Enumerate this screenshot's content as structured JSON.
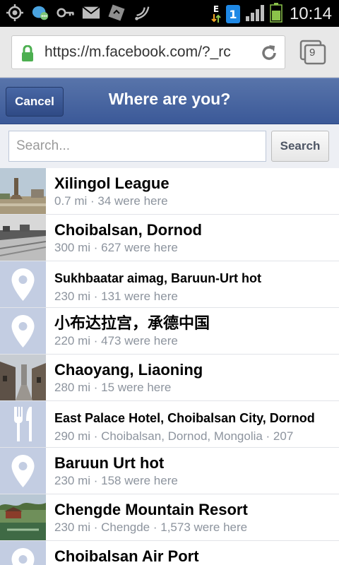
{
  "status_bar": {
    "time": "10:14",
    "sim_label": "1",
    "data_label": "E",
    "icons": [
      "gps-icon",
      "chat-icon",
      "key-icon",
      "mail-icon",
      "flip-icon",
      "nfc-icon",
      "data-icon",
      "sim-icon",
      "signal-icon",
      "battery-icon"
    ]
  },
  "browser": {
    "url": "https://m.facebook.com/?_rc",
    "tab_count": "9"
  },
  "header": {
    "cancel_label": "Cancel",
    "title": "Where are you?"
  },
  "search": {
    "placeholder": "Search...",
    "button_label": "Search"
  },
  "places": [
    {
      "title": "Xilingol League",
      "subtitle": "0.7 mi · 34 were here",
      "thumb": "photo-monument"
    },
    {
      "title": "Choibalsan, Dornod",
      "subtitle": "300 mi · 627 were here",
      "thumb": "photo-bw-town"
    },
    {
      "title": "Sukhbaatar aimag, Baruun-Urt hot",
      "subtitle": "230 mi · 131 were here",
      "thumb": "pin-icon"
    },
    {
      "title": "小布达拉宫，承德中国",
      "subtitle": "220 mi · 473 were here",
      "thumb": "pin-icon"
    },
    {
      "title": "Chaoyang, Liaoning",
      "subtitle": "280 mi · 15 were here",
      "thumb": "photo-street"
    },
    {
      "title": "East Palace Hotel, Choibalsan City, Dornod",
      "subtitle": "290 mi · Choibalsan, Dornod, Mongolia · 207",
      "thumb": "fork-knife-icon"
    },
    {
      "title": "Baruun Urt hot",
      "subtitle": "230 mi · 158 were here",
      "thumb": "pin-icon"
    },
    {
      "title": "Chengde Mountain Resort",
      "subtitle": "230 mi · Chengde · 1,573 were here",
      "thumb": "photo-resort"
    },
    {
      "title": "Choibalsan Air Port",
      "subtitle": "",
      "thumb": "pin-icon"
    }
  ],
  "colors": {
    "facebook_blue": "#3b5998",
    "pin_bg": "#c3cde2"
  }
}
